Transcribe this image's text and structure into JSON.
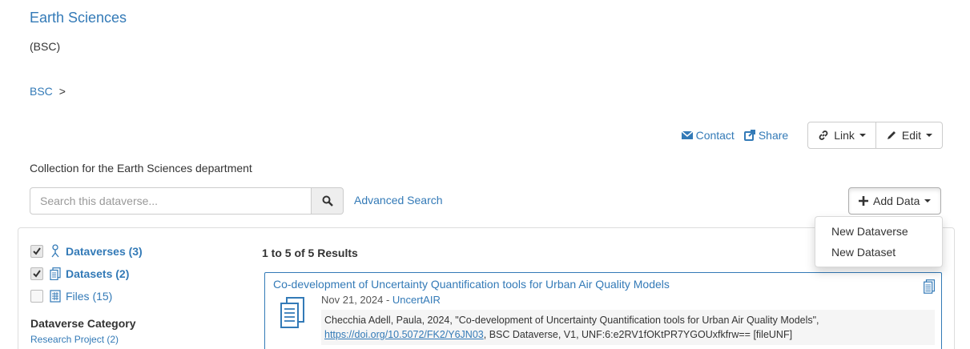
{
  "dataverse": {
    "title": "Earth Sciences",
    "affiliation": "(BSC)",
    "description": "Collection for the Earth Sciences department"
  },
  "breadcrumb": {
    "items": [
      "BSC"
    ],
    "separator": ">"
  },
  "actions": {
    "contact": "Contact",
    "share": "Share",
    "link": "Link",
    "edit": "Edit"
  },
  "search": {
    "placeholder": "Search this dataverse...",
    "advanced": "Advanced Search"
  },
  "add_data": {
    "label": "Add Data",
    "menu": [
      "New Dataverse",
      "New Dataset"
    ]
  },
  "facets": {
    "types": [
      {
        "label": "Dataverses (3)",
        "checked": true,
        "icon": "dataverse-icon"
      },
      {
        "label": "Datasets (2)",
        "checked": true,
        "icon": "dataset-icon"
      },
      {
        "label": "Files (15)",
        "checked": false,
        "icon": "file-icon"
      }
    ],
    "category_title": "Dataverse Category",
    "category_items": [
      "Research Project (2)"
    ]
  },
  "results": {
    "count_text": "1 to 5 of 5 Results",
    "items": [
      {
        "title": "Co-development of Uncertainty Quantification tools for Urban Air Quality Models",
        "date": "Nov 21, 2024 - ",
        "owner": "UncertAIR",
        "citation_pre": "Checchia Adell, Paula, 2024, \"Co-development of Uncertainty Quantification tools for Urban Air Quality Models\", ",
        "doi": "https://doi.org/10.5072/FK2/Y6JN03",
        "citation_post": ", BSC Dataverse, V1, UNF:6:e2RV1fOKtPR7YGOUxfkfrw== [fileUNF]"
      }
    ]
  },
  "colors": {
    "link": "#337ab7",
    "text": "#333333",
    "border": "#dddddd"
  }
}
